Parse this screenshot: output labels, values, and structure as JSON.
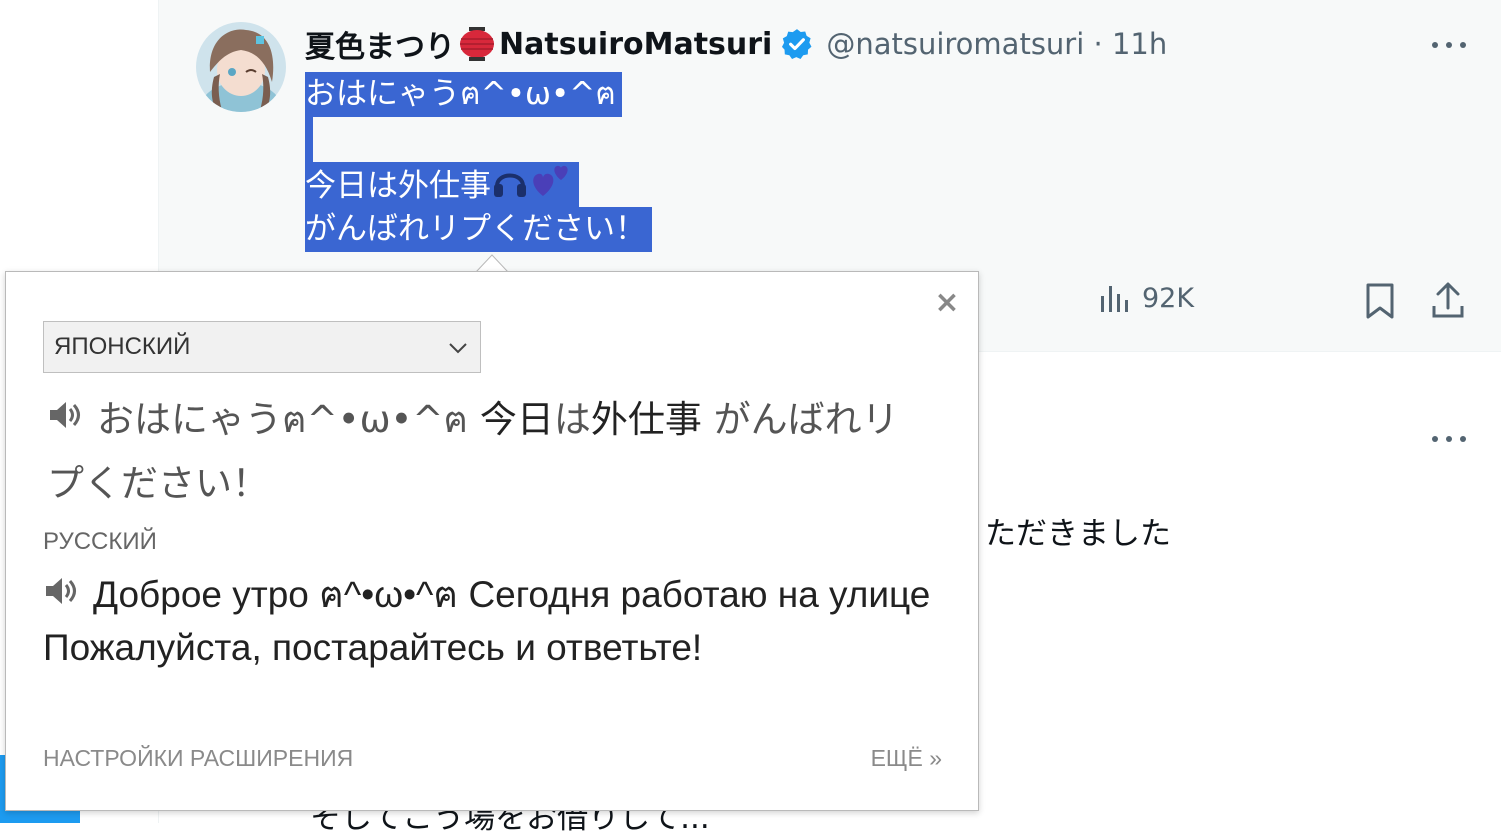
{
  "tweet": {
    "display_name": "夏色まつり",
    "display_name_suffix": "NatsuiroMatsuri",
    "handle_time": "@natsuiromatsuri · 11h",
    "text_lines": [
      "おはにゃうฅ^•ω•^ฅ",
      "",
      "今日は外仕事",
      "がんばれリプください！"
    ],
    "views_count": "92K"
  },
  "background_tweets": {
    "partial_text_1": "ただきました",
    "partial_text_2": "そしてこう場をお借りして..."
  },
  "translation_popup": {
    "source_language": "ЯПОНСКИЙ",
    "source_text_part1": "おはにゃうฅ^•ω•^ฅ",
    "source_text_part2": "今日",
    "source_text_part3": "は",
    "source_text_part4": "外仕事",
    "source_text_part5": "がんばれリプください！",
    "target_language": "РУССКИЙ",
    "translated_text": "Доброе утро ฅ^•ω•^ฅ Сегодня работаю на улице Пожалуйста, постарайтесь и ответьте!",
    "close_glyph": "×",
    "settings_link": "НАСТРОЙКИ РАСШИРЕНИЯ",
    "more_link": "ЕЩЁ »"
  },
  "colors": {
    "selection": "#3a66d2",
    "verified": "#1d9bf0",
    "muted": "#536471"
  },
  "icons": [
    "more-icon",
    "verified-icon",
    "lantern-icon",
    "views-icon",
    "bookmark-icon",
    "share-icon",
    "close-icon",
    "chevron-down-icon",
    "speaker-icon"
  ]
}
